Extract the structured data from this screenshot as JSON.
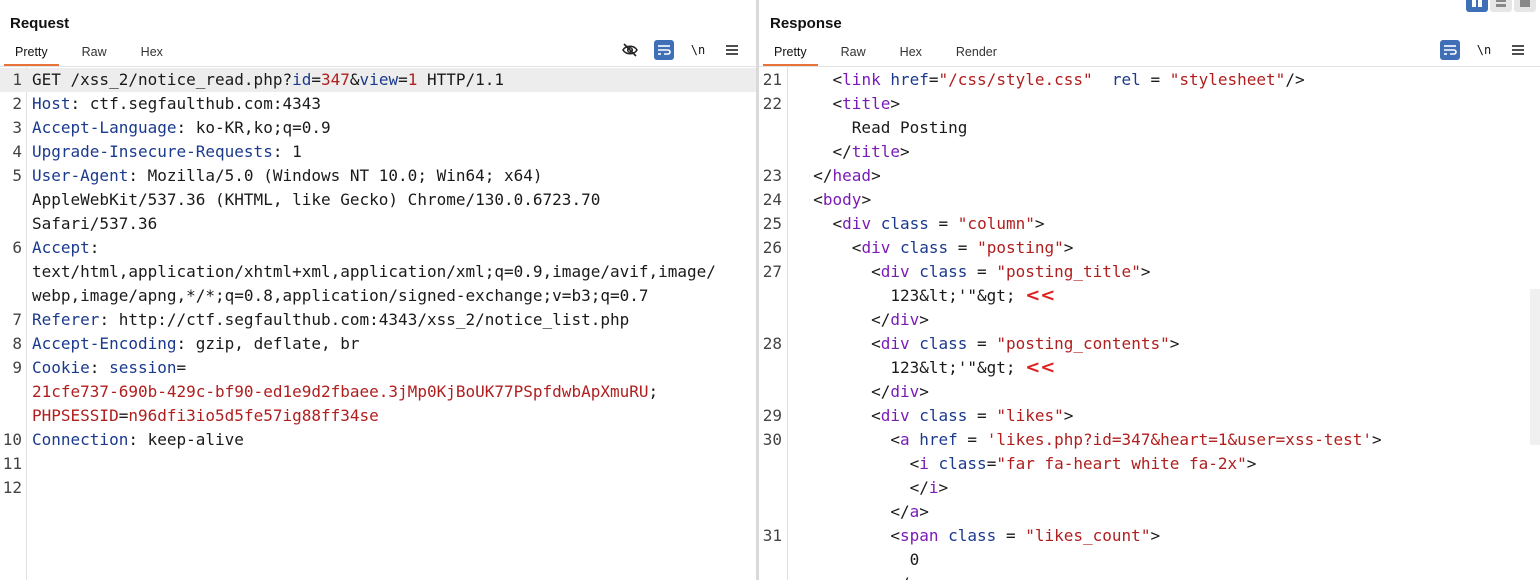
{
  "request": {
    "title": "Request",
    "tabs": [
      "Pretty",
      "Raw",
      "Hex"
    ],
    "active_tab": "Pretty",
    "toolbar": {
      "newline_label": "\\n"
    },
    "lines": [
      {
        "n": "1",
        "segs": [
          [
            "p",
            "GET /xss_2/notice_read.php?"
          ],
          [
            "k",
            "id"
          ],
          [
            "p",
            "="
          ],
          [
            "v",
            "347"
          ],
          [
            "p",
            "&"
          ],
          [
            "k",
            "view"
          ],
          [
            "p",
            "="
          ],
          [
            "v",
            "1"
          ],
          [
            "p",
            " HTTP/1.1"
          ]
        ],
        "hl": true
      },
      {
        "n": "2",
        "segs": [
          [
            "k",
            "Host"
          ],
          [
            "p",
            ": ctf.segfaulthub.com:4343"
          ]
        ]
      },
      {
        "n": "3",
        "segs": [
          [
            "k",
            "Accept-Language"
          ],
          [
            "p",
            ": ko-KR,ko;q=0.9"
          ]
        ]
      },
      {
        "n": "4",
        "segs": [
          [
            "k",
            "Upgrade-Insecure-Requests"
          ],
          [
            "p",
            ": 1"
          ]
        ]
      },
      {
        "n": "5",
        "segs": [
          [
            "k",
            "User-Agent"
          ],
          [
            "p",
            ": Mozilla/5.0 (Windows NT 10.0; Win64; x64)"
          ]
        ]
      },
      {
        "n": "",
        "segs": [
          [
            "p",
            "AppleWebKit/537.36 (KHTML, like Gecko) Chrome/130.0.6723.70"
          ]
        ]
      },
      {
        "n": "",
        "segs": [
          [
            "p",
            "Safari/537.36"
          ]
        ]
      },
      {
        "n": "6",
        "segs": [
          [
            "k",
            "Accept"
          ],
          [
            "p",
            ":"
          ]
        ]
      },
      {
        "n": "",
        "segs": [
          [
            "p",
            "text/html,application/xhtml+xml,application/xml;q=0.9,image/avif,image/"
          ]
        ]
      },
      {
        "n": "",
        "segs": [
          [
            "p",
            "webp,image/apng,*/*;q=0.8,application/signed-exchange;v=b3;q=0.7"
          ]
        ]
      },
      {
        "n": "7",
        "segs": [
          [
            "k",
            "Referer"
          ],
          [
            "p",
            ": http://ctf.segfaulthub.com:4343/xss_2/notice_list.php"
          ]
        ]
      },
      {
        "n": "8",
        "segs": [
          [
            "k",
            "Accept-Encoding"
          ],
          [
            "p",
            ": gzip, deflate, br"
          ]
        ]
      },
      {
        "n": "9",
        "segs": [
          [
            "k",
            "Cookie"
          ],
          [
            "p",
            ": "
          ],
          [
            "k",
            "session"
          ],
          [
            "p",
            "="
          ]
        ]
      },
      {
        "n": "",
        "segs": [
          [
            "v",
            "21cfe737-690b-429c-bf90-ed1e9d2fbaee.3jMp0KjBoUK77PSpfdwbApXmuRU"
          ],
          [
            "p",
            ";"
          ]
        ]
      },
      {
        "n": "",
        "segs": [
          [
            "v",
            "PHPSESSID"
          ],
          [
            "p",
            "="
          ],
          [
            "v",
            "n96dfi3io5d5fe57ig88ff34se"
          ]
        ]
      },
      {
        "n": "10",
        "segs": [
          [
            "k",
            "Connection"
          ],
          [
            "p",
            ": keep-alive"
          ]
        ]
      },
      {
        "n": "11",
        "segs": []
      },
      {
        "n": "12",
        "segs": []
      }
    ]
  },
  "response": {
    "title": "Response",
    "tabs": [
      "Pretty",
      "Raw",
      "Hex",
      "Render"
    ],
    "active_tab": "Pretty",
    "toolbar": {
      "newline_label": "\\n"
    },
    "lines": [
      {
        "n": "21",
        "segs": [
          [
            "p",
            "    <"
          ],
          [
            "t",
            "link"
          ],
          [
            "p",
            " "
          ],
          [
            "k",
            "href"
          ],
          [
            "p",
            "="
          ],
          [
            "v",
            "\"/css/style.css\""
          ],
          [
            "p",
            "  "
          ],
          [
            "k",
            "rel"
          ],
          [
            "p",
            " = "
          ],
          [
            "v",
            "\"stylesheet\""
          ],
          [
            "p",
            "/>"
          ]
        ]
      },
      {
        "n": "22",
        "segs": [
          [
            "p",
            "    <"
          ],
          [
            "t",
            "title"
          ],
          [
            "p",
            ">"
          ]
        ]
      },
      {
        "n": "",
        "segs": [
          [
            "p",
            "      Read Posting"
          ]
        ]
      },
      {
        "n": "",
        "segs": [
          [
            "p",
            "    </"
          ],
          [
            "t",
            "title"
          ],
          [
            "p",
            ">"
          ]
        ]
      },
      {
        "n": "23",
        "segs": [
          [
            "p",
            "  </"
          ],
          [
            "t",
            "head"
          ],
          [
            "p",
            ">"
          ]
        ]
      },
      {
        "n": "24",
        "segs": [
          [
            "p",
            "  <"
          ],
          [
            "t",
            "body"
          ],
          [
            "p",
            ">"
          ]
        ]
      },
      {
        "n": "25",
        "segs": [
          [
            "p",
            "    <"
          ],
          [
            "t",
            "div"
          ],
          [
            "p",
            " "
          ],
          [
            "k",
            "class"
          ],
          [
            "p",
            " = "
          ],
          [
            "v",
            "\"column\""
          ],
          [
            "p",
            ">"
          ]
        ]
      },
      {
        "n": "26",
        "segs": [
          [
            "p",
            "      <"
          ],
          [
            "t",
            "div"
          ],
          [
            "p",
            " "
          ],
          [
            "k",
            "class"
          ],
          [
            "p",
            " = "
          ],
          [
            "v",
            "\"posting\""
          ],
          [
            "p",
            ">"
          ]
        ]
      },
      {
        "n": "27",
        "segs": [
          [
            "p",
            "        <"
          ],
          [
            "t",
            "div"
          ],
          [
            "p",
            " "
          ],
          [
            "k",
            "class"
          ],
          [
            "p",
            " = "
          ],
          [
            "v",
            "\"posting_title\""
          ],
          [
            "p",
            ">"
          ]
        ]
      },
      {
        "n": "",
        "segs": [
          [
            "p",
            "          123&lt;'\"&gt; "
          ],
          [
            "a",
            "<<"
          ]
        ]
      },
      {
        "n": "",
        "segs": [
          [
            "p",
            "        </"
          ],
          [
            "t",
            "div"
          ],
          [
            "p",
            ">"
          ]
        ]
      },
      {
        "n": "28",
        "segs": [
          [
            "p",
            "        <"
          ],
          [
            "t",
            "div"
          ],
          [
            "p",
            " "
          ],
          [
            "k",
            "class"
          ],
          [
            "p",
            " = "
          ],
          [
            "v",
            "\"posting_contents\""
          ],
          [
            "p",
            ">"
          ]
        ]
      },
      {
        "n": "",
        "segs": [
          [
            "p",
            "          123&lt;'\"&gt; "
          ],
          [
            "a",
            "<<"
          ]
        ]
      },
      {
        "n": "",
        "segs": [
          [
            "p",
            "        </"
          ],
          [
            "t",
            "div"
          ],
          [
            "p",
            ">"
          ]
        ]
      },
      {
        "n": "29",
        "segs": [
          [
            "p",
            "        <"
          ],
          [
            "t",
            "div"
          ],
          [
            "p",
            " "
          ],
          [
            "k",
            "class"
          ],
          [
            "p",
            " = "
          ],
          [
            "v",
            "\"likes\""
          ],
          [
            "p",
            ">"
          ]
        ]
      },
      {
        "n": "30",
        "segs": [
          [
            "p",
            "          <"
          ],
          [
            "t",
            "a"
          ],
          [
            "p",
            " "
          ],
          [
            "k",
            "href"
          ],
          [
            "p",
            " = "
          ],
          [
            "v",
            "'likes.php?id=347&heart=1&user=xss-test'"
          ],
          [
            "p",
            ">"
          ]
        ]
      },
      {
        "n": "",
        "segs": [
          [
            "p",
            "            <"
          ],
          [
            "t",
            "i"
          ],
          [
            "p",
            " "
          ],
          [
            "k",
            "class"
          ],
          [
            "p",
            "="
          ],
          [
            "v",
            "\"far fa-heart white fa-2x\""
          ],
          [
            "p",
            ">"
          ]
        ]
      },
      {
        "n": "",
        "segs": [
          [
            "p",
            "            </"
          ],
          [
            "t",
            "i"
          ],
          [
            "p",
            ">"
          ]
        ]
      },
      {
        "n": "",
        "segs": [
          [
            "p",
            "          </"
          ],
          [
            "t",
            "a"
          ],
          [
            "p",
            ">"
          ]
        ]
      },
      {
        "n": "31",
        "segs": [
          [
            "p",
            "          <"
          ],
          [
            "t",
            "span"
          ],
          [
            "p",
            " "
          ],
          [
            "k",
            "class"
          ],
          [
            "p",
            " = "
          ],
          [
            "v",
            "\"likes_count\""
          ],
          [
            "p",
            ">"
          ]
        ]
      },
      {
        "n": "",
        "segs": [
          [
            "p",
            "            0"
          ]
        ]
      },
      {
        "n": "",
        "segs": [
          [
            "p",
            "          </"
          ]
        ]
      }
    ]
  },
  "colors": {
    "accent": "#e8733a",
    "button_blue": "#3f6fb7",
    "key": "#1b3a8c",
    "value": "#b01e1e",
    "tag": "#7a1bb5",
    "annotation": "#e02020"
  }
}
